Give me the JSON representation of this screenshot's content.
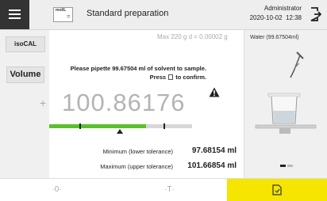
{
  "header": {
    "menu_icon": "hamburger-icon",
    "unit_icon_text": "mol/L",
    "unit_icon_symbol": "=",
    "method_title": "Standard preparation",
    "user_name": "Administrator",
    "date": "2020-10-02",
    "time": "12:38",
    "logout_icon": "logout-icon"
  },
  "left_panel": {
    "isocal_label": "isoCAL",
    "volume_label": "Volume"
  },
  "main": {
    "capacity_text": "Max 220 g   d = 0.00002 g",
    "instruction_line1": "Please pipette 99.67504 ml of solvent to sample.",
    "instruction_press": "Press",
    "instruction_confirm": "to confirm.",
    "sign": "+",
    "reading": "100.86176",
    "warning_icon": "warning-icon",
    "tolerance_fill_fraction": 0.68,
    "min_label": "Minimum (lower tolerance)",
    "min_value": "97.68154 ml",
    "max_label": "Maximum (upper tolerance)",
    "max_value": "101.66854 ml"
  },
  "right_panel": {
    "component_label": "Water (99.67504ml)",
    "illustration": "pipette-beaker-illustration",
    "page_indicator": {
      "current": 1,
      "total": 2
    }
  },
  "footer": {
    "zero_label": "·0·",
    "tare_label": "·T·",
    "finish_icon": "document-confirm-icon"
  },
  "colors": {
    "accent_yellow": "#f5e500",
    "progress_green": "#5cc02c",
    "header_dark": "#333333"
  }
}
